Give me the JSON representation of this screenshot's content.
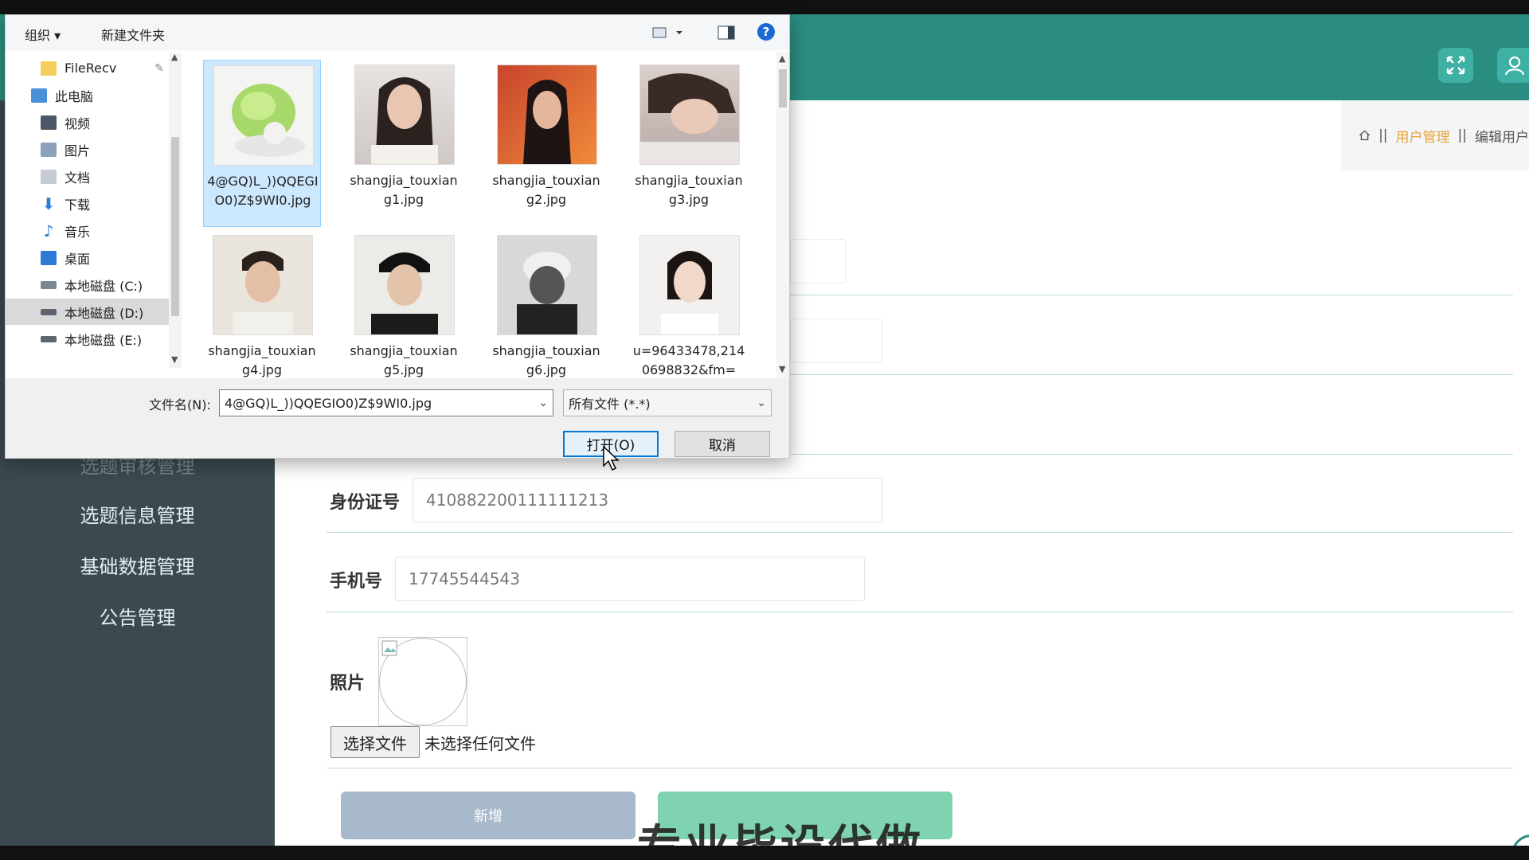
{
  "app": {
    "sidebar_items": [
      "选题审核管理",
      "选题信息管理",
      "基础数据管理",
      "公告管理"
    ],
    "breadcrumb": {
      "current": "用户管理",
      "page": "编辑用户"
    },
    "form": {
      "id_label": "身份证号",
      "id_value": "410882200111111213",
      "phone_label": "手机号",
      "phone_value": "17745544543",
      "photo_label": "照片",
      "file_button": "选择文件",
      "file_status": "未选择任何文件",
      "add_button": "新增"
    },
    "watermark": "专业毕设代做",
    "colors": {
      "header": "#2b8d80",
      "sidebar": "#3a4a4f",
      "accent": "#e8a23a"
    }
  },
  "dialog": {
    "toolbar": {
      "organize": "组织 ▾",
      "new_folder": "新建文件夹",
      "help": "?"
    },
    "nav": [
      {
        "label": "FileRecv",
        "icon": "folder-icon"
      },
      {
        "label": "此电脑",
        "icon": "computer-icon"
      },
      {
        "label": "视频",
        "icon": "video-icon"
      },
      {
        "label": "图片",
        "icon": "pictures-icon"
      },
      {
        "label": "文档",
        "icon": "documents-icon"
      },
      {
        "label": "下载",
        "icon": "download-icon"
      },
      {
        "label": "音乐",
        "icon": "music-icon"
      },
      {
        "label": "桌面",
        "icon": "desktop-icon"
      },
      {
        "label": "本地磁盘 (C:)",
        "icon": "drive-icon"
      },
      {
        "label": "本地磁盘 (D:)",
        "icon": "drive-icon"
      },
      {
        "label": "本地磁盘 (E:)",
        "icon": "drive-icon"
      }
    ],
    "files": [
      {
        "name": "4@GQ)L_))QQEGIO0)Z$9WI0.jpg",
        "selected": true
      },
      {
        "name": "shangjia_touxiang1.jpg"
      },
      {
        "name": "shangjia_touxiang2.jpg"
      },
      {
        "name": "shangjia_touxiang3.jpg"
      },
      {
        "name": "shangjia_touxiang4.jpg"
      },
      {
        "name": "shangjia_touxiang5.jpg"
      },
      {
        "name": "shangjia_touxiang6.jpg"
      },
      {
        "name": "u=96433478,2140698832&fm="
      }
    ],
    "filename_label": "文件名(N):",
    "filename_value": "4@GQ)L_))QQEGIO0)Z$9WI0.jpg",
    "filetype_value": "所有文件 (*.*)",
    "open_button": "打开(O)",
    "cancel_button": "取消"
  }
}
